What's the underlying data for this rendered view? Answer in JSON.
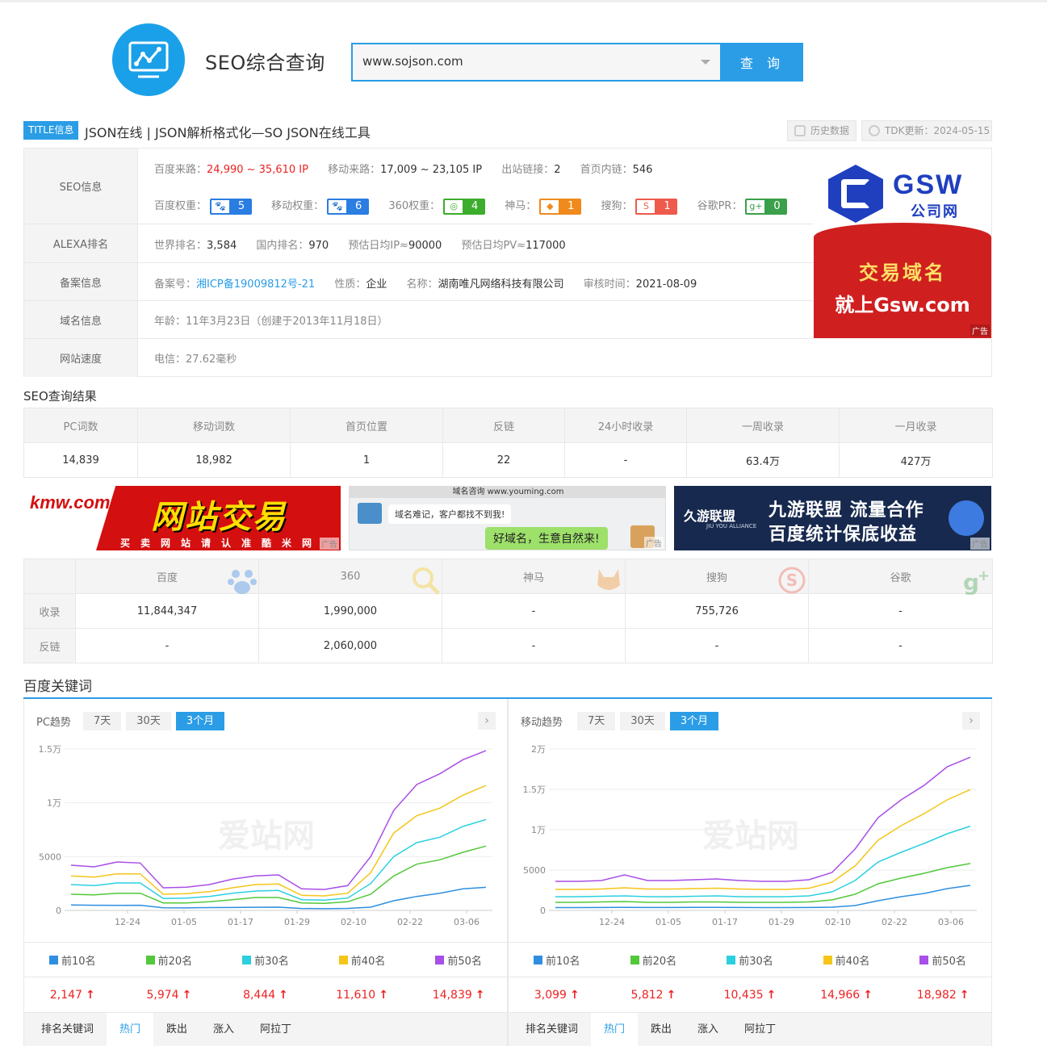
{
  "header": {
    "site_title": "SEO综合查询",
    "search_value": "www.sojson.com",
    "search_button": "查 询"
  },
  "title_bar": {
    "tag": "TITLE信息",
    "title": "JSON在线 | JSON解析格式化—SO JSON在线工具",
    "history_button": "历史数据",
    "tdk_update": "TDK更新：2024-05-15"
  },
  "seo_info": {
    "labels": [
      "SEO信息",
      "ALEXA排名",
      "备案信息",
      "域名信息",
      "网站速度"
    ],
    "baidu_traffic_label": "百度来路：",
    "baidu_traffic": "24,990 ~ 35,610 IP",
    "mobile_traffic_label": "移动来路：",
    "mobile_traffic": "17,009 ~ 23,105 IP",
    "outbound_label": "出站链接：",
    "outbound": "2",
    "inbound_label": "首页内链：",
    "inbound": "546",
    "weights": [
      {
        "label": "百度权重：",
        "value": "5",
        "color": "#2a7de1",
        "icon": "paw-icon"
      },
      {
        "label": "移动权重：",
        "value": "6",
        "color": "#2a7de1",
        "icon": "paw-icon"
      },
      {
        "label": "360权重：",
        "value": "4",
        "color": "#3cad2c",
        "icon": "360-icon"
      },
      {
        "label": "神马：",
        "value": "1",
        "color": "#f08a1d",
        "icon": "shenma-icon"
      },
      {
        "label": "搜狗：",
        "value": "1",
        "color": "#ee5a4b",
        "icon": "sogou-icon"
      },
      {
        "label": "谷歌PR：",
        "value": "0",
        "color": "#3aa04a",
        "icon": "google-plus-icon"
      }
    ],
    "world_rank_label": "世界排名：",
    "world_rank": "3,584",
    "domestic_rank_label": "国内排名：",
    "domestic_rank": "970",
    "est_ip_label": "预估日均IP≈",
    "est_ip": "90000",
    "est_pv_label": "预估日均PV≈",
    "est_pv": "117000",
    "icp_label": "备案号：",
    "icp": "湘ICP备19009812号-21",
    "nature_label": "性质：",
    "nature": "企业",
    "name_label": "名称：",
    "name": "湖南唯凡网络科技有限公司",
    "audit_label": "审核时间：",
    "audit": "2021-08-09",
    "domain_age_label": "年龄：",
    "domain_age": "11年3月23日（创建于2013年11月18日）",
    "speed": "电信：27.62毫秒"
  },
  "gsw_ad": {
    "name": "GSW",
    "sub": "公司网",
    "line1": "交易域名",
    "line2": "就上Gsw.com",
    "mark": "广告"
  },
  "seo_result": {
    "title": "SEO查询结果",
    "headers": [
      "PC词数",
      "移动词数",
      "首页位置",
      "反链",
      "24小时收录",
      "一周收录",
      "一月收录"
    ],
    "values": [
      "14,839",
      "18,982",
      "1",
      "22",
      "-",
      "63.4万",
      "427万"
    ]
  },
  "banners": {
    "b1_logo": "kmw.com",
    "b1_big": "网站交易",
    "b1_small": "买卖网站请认准酷米网",
    "b2_head": "域名咨询 www.youming.com",
    "b2_msg1": "域名难记，客户都找不到我!",
    "b2_msg2": "好域名，生意自然来!",
    "b3_logo": "久游联盟",
    "b3_logo_sub": "JIU YOU ALLIANCE",
    "b3_line1": "九游联盟 流量合作",
    "b3_line2": "百度统计保底收益",
    "mark": "广告"
  },
  "engines": {
    "headers": [
      "百度",
      "360",
      "神马",
      "搜狗",
      "谷歌"
    ],
    "rows": [
      {
        "label": "收录",
        "values": [
          "11,844,347",
          "1,990,000",
          "-",
          "755,726",
          "-"
        ]
      },
      {
        "label": "反链",
        "values": [
          "-",
          "2,060,000",
          "-",
          "-",
          "-"
        ]
      }
    ]
  },
  "keywords": {
    "title": "百度关键词",
    "panels": [
      {
        "title": "PC趋势",
        "tabs": [
          "7天",
          "30天",
          "3个月"
        ],
        "active_tab": 2,
        "counts": [
          "2,147",
          "5,974",
          "8,444",
          "11,610",
          "14,839"
        ]
      },
      {
        "title": "移动趋势",
        "tabs": [
          "7天",
          "30天",
          "3个月"
        ],
        "active_tab": 2,
        "counts": [
          "3,099",
          "5,812",
          "10,435",
          "14,966",
          "18,982"
        ]
      }
    ],
    "legend": [
      "前10名",
      "前20名",
      "前30名",
      "前40名",
      "前50名"
    ],
    "colors": [
      "#2e8fe0",
      "#52c83a",
      "#2bd0e0",
      "#f5c518",
      "#a94ee6"
    ],
    "bottom_tabs": [
      "排名关键词",
      "热门",
      "跌出",
      "涨入",
      "阿拉丁"
    ],
    "watermark": "爱站网"
  },
  "chart_data": [
    {
      "type": "line",
      "x_ticks": [
        "12-24",
        "01-05",
        "01-17",
        "01-29",
        "02-10",
        "02-22",
        "03-06"
      ],
      "y_ticks": [
        "0",
        "5000",
        "1万",
        "1.5万"
      ],
      "ylim": [
        0,
        15000
      ],
      "series": [
        {
          "name": "前10名",
          "values": [
            500,
            480,
            470,
            480,
            250,
            230,
            260,
            270,
            290,
            300,
            180,
            160,
            190,
            300,
            900,
            1300,
            1600,
            2000,
            2147
          ]
        },
        {
          "name": "前20名",
          "values": [
            1500,
            1450,
            1600,
            1600,
            700,
            700,
            800,
            1000,
            1200,
            1200,
            700,
            650,
            800,
            1500,
            3200,
            4300,
            4700,
            5400,
            5974
          ]
        },
        {
          "name": "前30名",
          "values": [
            2400,
            2300,
            2550,
            2550,
            1100,
            1150,
            1300,
            1600,
            1800,
            1850,
            1000,
            950,
            1150,
            2500,
            5000,
            6300,
            6800,
            7800,
            8444
          ]
        },
        {
          "name": "前40名",
          "values": [
            3200,
            3100,
            3400,
            3400,
            1500,
            1550,
            1750,
            2100,
            2400,
            2450,
            1400,
            1350,
            1600,
            3500,
            7200,
            8800,
            9500,
            10700,
            11610
          ]
        },
        {
          "name": "前50名",
          "values": [
            4200,
            4050,
            4500,
            4400,
            2100,
            2150,
            2400,
            2900,
            3200,
            3300,
            2000,
            1950,
            2300,
            5000,
            9300,
            11700,
            12700,
            14000,
            14839
          ]
        }
      ]
    },
    {
      "type": "line",
      "x_ticks": [
        "12-24",
        "01-05",
        "01-17",
        "01-29",
        "02-10",
        "02-22",
        "03-06"
      ],
      "y_ticks": [
        "0",
        "5000",
        "1万",
        "1.5万",
        "2万"
      ],
      "ylim": [
        0,
        20000
      ],
      "series": [
        {
          "name": "前10名",
          "values": [
            350,
            350,
            360,
            380,
            360,
            360,
            370,
            380,
            360,
            350,
            350,
            360,
            400,
            600,
            1200,
            1700,
            2100,
            2700,
            3099
          ]
        },
        {
          "name": "前20名",
          "values": [
            1000,
            1000,
            1050,
            1100,
            1000,
            1000,
            1050,
            1050,
            1000,
            1000,
            1000,
            1050,
            1300,
            2000,
            3300,
            4000,
            4600,
            5300,
            5812
          ]
        },
        {
          "name": "前30名",
          "values": [
            1700,
            1700,
            1750,
            1800,
            1700,
            1700,
            1750,
            1800,
            1700,
            1700,
            1700,
            1800,
            2300,
            3700,
            6000,
            7200,
            8300,
            9500,
            10435
          ]
        },
        {
          "name": "前40名",
          "values": [
            2600,
            2600,
            2650,
            2800,
            2650,
            2650,
            2700,
            2750,
            2650,
            2600,
            2600,
            2750,
            3500,
            5500,
            8700,
            10500,
            12000,
            13700,
            14966
          ]
        },
        {
          "name": "前50名",
          "values": [
            3600,
            3600,
            3700,
            4400,
            3700,
            3700,
            3800,
            3900,
            3700,
            3600,
            3600,
            3800,
            4700,
            7600,
            11500,
            13700,
            15500,
            17800,
            18982
          ]
        }
      ]
    }
  ]
}
